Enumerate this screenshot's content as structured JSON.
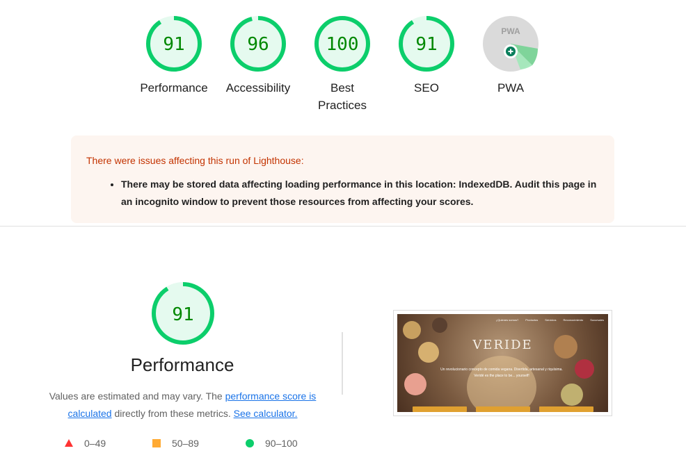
{
  "gauges": [
    {
      "score": "91",
      "label": "Performance",
      "value": 91
    },
    {
      "score": "96",
      "label": "Accessibility",
      "value": 96
    },
    {
      "score": "100",
      "label_line1": "Best",
      "label_line2": "Practices",
      "value": 100
    },
    {
      "score": "91",
      "label": "SEO",
      "value": 91
    },
    {
      "badge": "PWA",
      "label": "PWA"
    }
  ],
  "warning": {
    "title": "There were issues affecting this run of Lighthouse:",
    "item": "There may be stored data affecting loading performance in this location: IndexedDB. Audit this page in an incognito window to prevent those resources from affecting your scores."
  },
  "performance": {
    "score": "91",
    "value": 91,
    "title": "Performance",
    "desc_pre": "Values are estimated and may vary. The ",
    "link_score": "performance score is calculated",
    "desc_mid": " directly from these metrics. ",
    "link_calc": "See calculator."
  },
  "legend": [
    {
      "range": "0–49",
      "color": "#ff3333",
      "shape": "triangle"
    },
    {
      "range": "50–89",
      "color": "#ffaa33",
      "shape": "square"
    },
    {
      "range": "90–100",
      "color": "#0cce6b",
      "shape": "circle"
    }
  ],
  "thumbnail": {
    "nav": [
      "¿Quienes somos?",
      "Productos",
      "Servicios",
      "Reconocimiento",
      "Sucursales"
    ],
    "brand": "VERIDE",
    "tagline": "Un revolucionario concepto de comida vegana. Divertida, artesanal y riquísima. Veridé es the place to be... yourself!"
  },
  "colors": {
    "pass": "#0cce6b",
    "pass_bg": "#e5faef",
    "score_text": "#008800",
    "link": "#1a73e8"
  }
}
